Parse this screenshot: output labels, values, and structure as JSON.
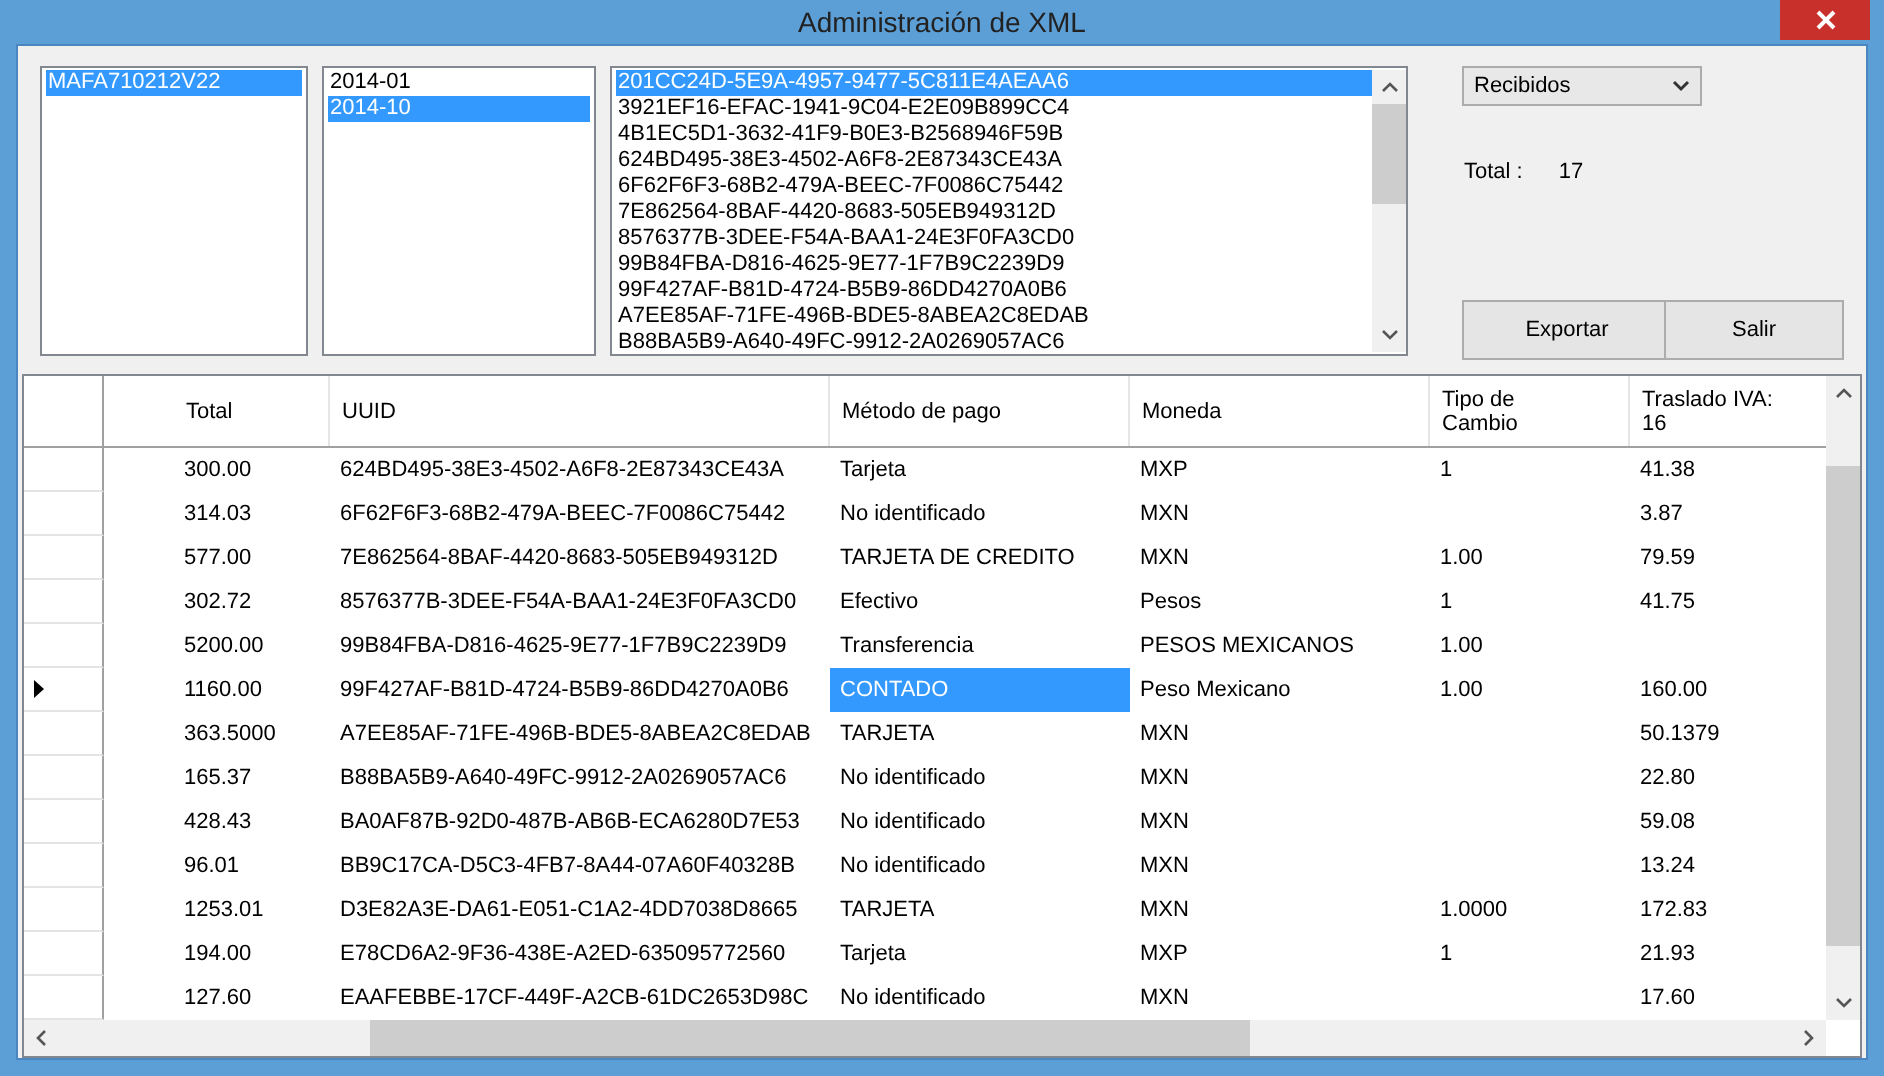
{
  "window": {
    "title": "Administración de XML"
  },
  "rfc_list": [
    {
      "text": "MAFA710212V22",
      "selected": true
    }
  ],
  "period_list": [
    {
      "text": "2014-01",
      "selected": false
    },
    {
      "text": "2014-10",
      "selected": true
    }
  ],
  "uuid_list": [
    {
      "text": "201CC24D-5E9A-4957-9477-5C811E4AEAA6",
      "selected": true
    },
    {
      "text": "3921EF16-EFAC-1941-9C04-E2E09B899CC4",
      "selected": false
    },
    {
      "text": "4B1EC5D1-3632-41F9-B0E3-B2568946F59B",
      "selected": false
    },
    {
      "text": "624BD495-38E3-4502-A6F8-2E87343CE43A",
      "selected": false
    },
    {
      "text": "6F62F6F3-68B2-479A-BEEC-7F0086C75442",
      "selected": false
    },
    {
      "text": "7E862564-8BAF-4420-8683-505EB949312D",
      "selected": false
    },
    {
      "text": "8576377B-3DEE-F54A-BAA1-24E3F0FA3CD0",
      "selected": false
    },
    {
      "text": "99B84FBA-D816-4625-9E77-1F7B9C2239D9",
      "selected": false
    },
    {
      "text": "99F427AF-B81D-4724-B5B9-86DD4270A0B6",
      "selected": false
    },
    {
      "text": "A7EE85AF-71FE-496B-BDE5-8ABEA2C8EDAB",
      "selected": false
    },
    {
      "text": "B88BA5B9-A640-49FC-9912-2A0269057AC6",
      "selected": false
    }
  ],
  "type_dropdown": {
    "value": "Recibidos"
  },
  "total": {
    "label": "Total :",
    "value": "17"
  },
  "buttons": [
    "Exportar",
    "Salir"
  ],
  "table": {
    "columns": [
      "Total",
      "UUID",
      "Método de pago",
      "Moneda",
      "Tipo de Cambio",
      "Traslado IVA: 16"
    ],
    "rows": [
      {
        "total": "300.00",
        "uuid": "624BD495-38E3-4502-A6F8-2E87343CE43A",
        "metodo": "Tarjeta",
        "moneda": "MXP",
        "tipo_cambio": "1",
        "traslado_iva": "41.38",
        "current": false,
        "metodo_selected": false
      },
      {
        "total": "314.03",
        "uuid": "6F62F6F3-68B2-479A-BEEC-7F0086C75442",
        "metodo": "No identificado",
        "moneda": "MXN",
        "traslado_iva": "3.87",
        "current": false,
        "metodo_selected": false
      },
      {
        "total": "577.00",
        "uuid": "7E862564-8BAF-4420-8683-505EB949312D",
        "metodo": "TARJETA DE CREDITO",
        "moneda": "MXN",
        "tipo_cambio": "1.00",
        "traslado_iva": "79.59",
        "current": false,
        "metodo_selected": false
      },
      {
        "total": "302.72",
        "uuid": "8576377B-3DEE-F54A-BAA1-24E3F0FA3CD0",
        "metodo": "Efectivo",
        "moneda": "Pesos",
        "tipo_cambio": "1",
        "traslado_iva": "41.75",
        "current": false,
        "metodo_selected": false
      },
      {
        "total": "5200.00",
        "uuid": "99B84FBA-D816-4625-9E77-1F7B9C2239D9",
        "metodo": "Transferencia",
        "moneda": "PESOS MEXICANOS",
        "tipo_cambio": "1.00",
        "current": false,
        "metodo_selected": false
      },
      {
        "total": "1160.00",
        "uuid": "99F427AF-B81D-4724-B5B9-86DD4270A0B6",
        "metodo": "CONTADO",
        "moneda": "Peso Mexicano",
        "tipo_cambio": "1.00",
        "traslado_iva": "160.00",
        "current": true,
        "metodo_selected": true
      },
      {
        "total": "363.5000",
        "uuid": "A7EE85AF-71FE-496B-BDE5-8ABEA2C8EDAB",
        "metodo": "TARJETA",
        "moneda": "MXN",
        "traslado_iva": "50.1379",
        "current": false,
        "metodo_selected": false
      },
      {
        "total": "165.37",
        "uuid": "B88BA5B9-A640-49FC-9912-2A0269057AC6",
        "metodo": "No identificado",
        "moneda": "MXN",
        "traslado_iva": "22.80",
        "current": false,
        "metodo_selected": false
      },
      {
        "total": "428.43",
        "uuid": "BA0AF87B-92D0-487B-AB6B-ECA6280D7E53",
        "metodo": "No identificado",
        "moneda": "MXN",
        "traslado_iva": "59.08",
        "current": false,
        "metodo_selected": false
      },
      {
        "total": "96.01",
        "uuid": "BB9C17CA-D5C3-4FB7-8A44-07A60F40328B",
        "metodo": "No identificado",
        "moneda": "MXN",
        "traslado_iva": "13.24",
        "current": false,
        "metodo_selected": false
      },
      {
        "total": "1253.01",
        "uuid": "D3E82A3E-DA61-E051-C1A2-4DD7038D8665",
        "metodo": "TARJETA",
        "moneda": "MXN",
        "tipo_cambio": "1.0000",
        "traslado_iva": "172.83",
        "current": false,
        "metodo_selected": false
      },
      {
        "total": "194.00",
        "uuid": "E78CD6A2-9F36-438E-A2ED-635095772560",
        "metodo": "Tarjeta",
        "moneda": "MXP",
        "tipo_cambio": "1",
        "traslado_iva": "21.93",
        "current": false,
        "metodo_selected": false
      },
      {
        "total": "127.60",
        "uuid": "EAAFEBBE-17CF-449F-A2CB-61DC2653D98C",
        "metodo": "No identificado",
        "moneda": "MXN",
        "traslado_iva": "17.60",
        "current": false,
        "metodo_selected": false
      }
    ]
  }
}
